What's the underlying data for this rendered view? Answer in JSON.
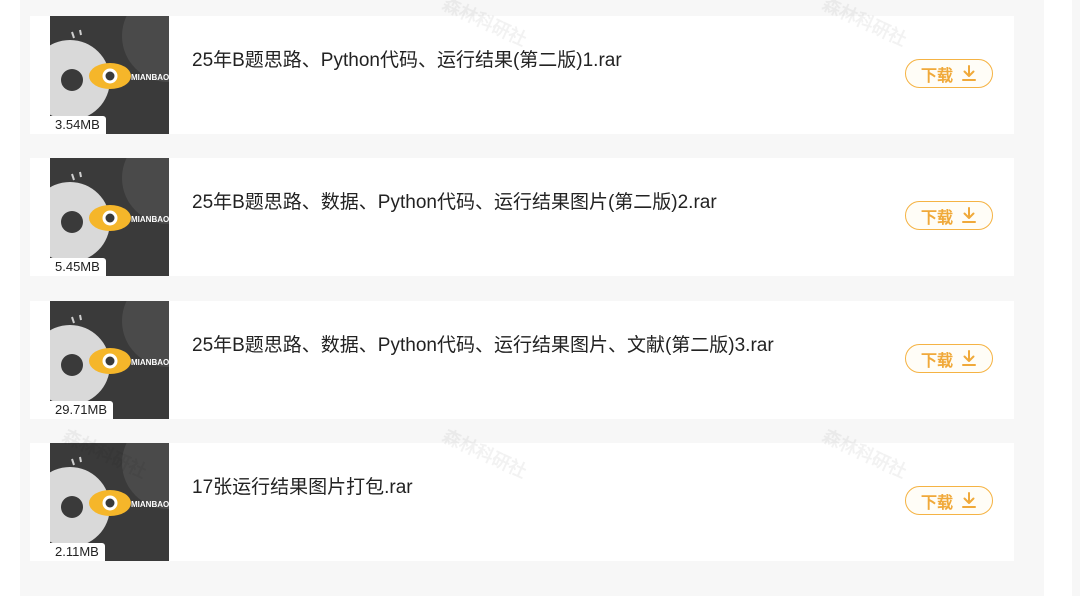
{
  "files": [
    {
      "name": "25年B题思路、Python代码、运行结果(第二版)1.rar",
      "size": "3.54MB",
      "thumb_brand": "MIANBAO",
      "download_label": "下载"
    },
    {
      "name": "25年B题思路、数据、Python代码、运行结果图片(第二版)2.rar",
      "size": "5.45MB",
      "thumb_brand": "MIANBAO",
      "download_label": "下载"
    },
    {
      "name": "25年B题思路、数据、Python代码、运行结果图片、文献(第二版)3.rar",
      "size": "29.71MB",
      "thumb_brand": "MIANBAO",
      "download_label": "下载"
    },
    {
      "name": "17张运行结果图片打包.rar",
      "size": "2.11MB",
      "thumb_brand": "MIANBAO",
      "download_label": "下载"
    }
  ],
  "watermark_text": "森林科研社",
  "colors": {
    "accent": "#f0a93a",
    "thumb_bg": "#3a3a3a",
    "eye": "#f5b62a"
  }
}
